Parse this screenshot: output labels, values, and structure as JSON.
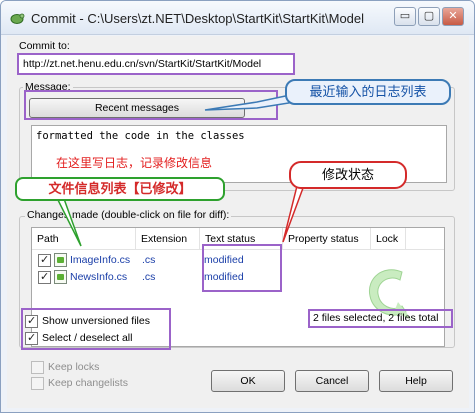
{
  "window": {
    "title": "Commit - C:\\Users\\zt.NET\\Desktop\\StartKit\\StartKit\\Model",
    "controls": {
      "minimize": "▭",
      "maximize": "▢",
      "close": "✕"
    }
  },
  "commit_to": {
    "label": "Commit to:",
    "url": "http://zt.net.henu.edu.cn/svn/StartKit/StartKit/Model"
  },
  "message": {
    "group_label": "Message:",
    "recent_button": "Recent messages",
    "text": "formatted the code in the classes",
    "hint": "在这里写日志，记录修改信息"
  },
  "changes": {
    "group_label": "Changes made (double-click on file for diff):",
    "columns": [
      "Path",
      "Extension",
      "Text status",
      "Property status",
      "Lock"
    ],
    "files": [
      {
        "checked": true,
        "path": "ImageInfo.cs",
        "extension": ".cs",
        "text_status": "modified",
        "property_status": "",
        "lock": ""
      },
      {
        "checked": true,
        "path": "NewsInfo.cs",
        "extension": ".cs",
        "text_status": "modified",
        "property_status": "",
        "lock": ""
      }
    ],
    "selection_status": "2 files selected, 2 files total"
  },
  "options": {
    "show_unversioned": "Show unversioned files",
    "select_deselect": "Select / deselect all",
    "keep_locks": "Keep locks",
    "keep_changelists": "Keep changelists"
  },
  "buttons": {
    "ok": "OK",
    "cancel": "Cancel",
    "help": "Help"
  },
  "annotations": {
    "recent_messages": "最近输入的日志列表",
    "file_list": "文件信息列表【已修改】",
    "modify_status": "修改状态"
  },
  "colors": {
    "highlight_purple": "#9b63c9",
    "annotation_blue": "#3c7ab5",
    "annotation_red": "#d42a2a",
    "annotation_green": "#2ea12e",
    "status_text": "#1a3ea8"
  }
}
